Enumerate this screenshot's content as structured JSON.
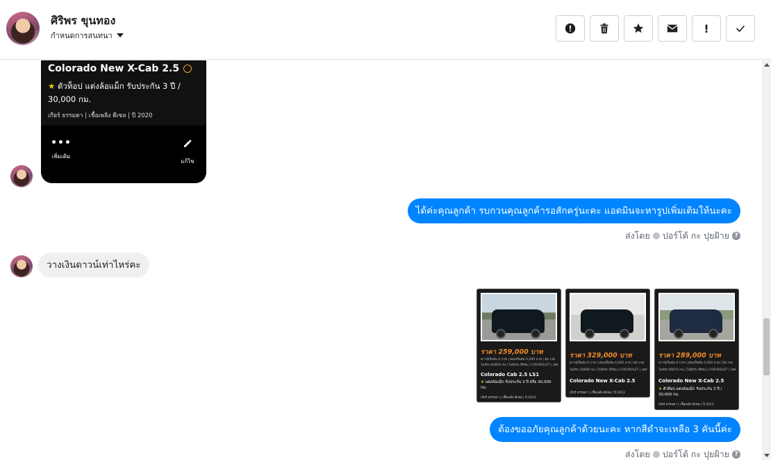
{
  "header": {
    "contact_name": "ศิริพร ขุนทอง",
    "assign_label": "กำหนดการสนทนา",
    "actions": [
      {
        "name": "alert-icon"
      },
      {
        "name": "trash-icon"
      },
      {
        "name": "star-icon"
      },
      {
        "name": "mail-icon"
      },
      {
        "name": "exclamation-icon",
        "text": "!"
      },
      {
        "name": "check-icon"
      }
    ]
  },
  "card": {
    "paren": ")",
    "model": "Colorado New X-Cab 2.5",
    "desc": "ตัวท็อป แต่งล้อแม็ก รับประกัน 3 ปี / 30,000 กม.",
    "specs": "เกียร์ ธรรมดา  |  เชื้อเพลิง ดีเซล  |  ปี 2020",
    "more_label": "เพิ่มเติม",
    "edit_label": "แก้ไข"
  },
  "messages": {
    "out1": "ได้ค่ะคุณลูกค้า รบกวนคุณลูกค้ารอสักครู่นะคะ แอดมินจะหารูปเพิ่มเติมให้นะคะ",
    "sent_by_prefix": "ส่งโดย",
    "sent_by_name": "ปอร์โต้ กะ ปุยฝ้าย",
    "in1": "วางเงินดาวน์เท่าไหร่คะ",
    "out2": "ต้องขออภัยคุณลูกค้าด้วยนะคะ หากสีดำจะเหลือ 3 คันนี้ค่ะ"
  },
  "thumbs": [
    {
      "price": "ราคา 259,000 บาท",
      "finance": "ดาวน์เริ่มต้น 0 บาท | ผ่อนเริ่มต้น 5,000 บาท | 84 งวด",
      "tags": "ไมล์รถ 84859 กม.| ไม่มีประวัติชน | CHEVROLET | เทคโนโลยี",
      "model": "Colorado Cab 2.5 LS1",
      "desc": "แต่งล้อแม็ก รับประกัน 3 ปี หรือ 30,000 กม.",
      "specs": "เกียร์ ธรรมดา   |  เชื้อเพลิง ดีเซล  |  ปี 2011"
    },
    {
      "price": "ราคา 329,000 บาท",
      "finance": "ดาวน์เริ่มต้น 0 บาท | ผ่อนเริ่มต้น 6,000 บาท | 84 งวด",
      "tags": "ไมล์รถ 26808 กม.| ไม่มีประวัติชน | CHEVROLET | เทคโนโลยี",
      "model": "Colorado New X-Cab 2.5",
      "desc": "",
      "specs": "เกียร์ ธรรมดา   |  เชื้อเพลิง ดีเซล  |  ปี 2013"
    },
    {
      "price": "ราคา 289,000 บาท",
      "finance": "ดาวน์เริ่มต้น 0 บาท | ผ่อนเริ่มต้น 5,000 บาท | 84 งวด",
      "tags": "ไมล์รถ 90875 กม.| ไม่มีประวัติชน | CHEVROLET | เทคโนโลยี",
      "model": "Colorado New X-Cab 2.5",
      "desc": "ตัวท็อป แต่งล้อแม็ก รับประกัน 3 ปี / 30,000 กม.",
      "specs": "เกียร์ ธรรมดา   |  เชื้อเพลิง ดีเซล  |  ปี 2013"
    }
  ]
}
